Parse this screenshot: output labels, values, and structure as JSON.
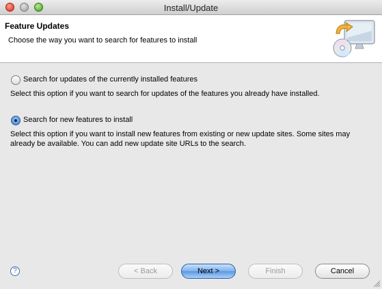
{
  "window": {
    "title": "Install/Update"
  },
  "banner": {
    "title": "Feature Updates",
    "description": "Choose the way you want to search for features to install",
    "icon": "install-update-icon"
  },
  "options": [
    {
      "label": "Search for updates of the currently installed features",
      "description": "Select this option if you want to search for updates of the features you already have installed.",
      "selected": false
    },
    {
      "label": "Search for new features to install",
      "description": "Select this option if you want to install new features from existing or new update sites. Some sites may already be available. You can add new update site URLs to the search.",
      "selected": true
    }
  ],
  "footer": {
    "help_icon": "?",
    "back_label": "< Back",
    "next_label": "Next >",
    "finish_label": "Finish",
    "cancel_label": "Cancel"
  }
}
